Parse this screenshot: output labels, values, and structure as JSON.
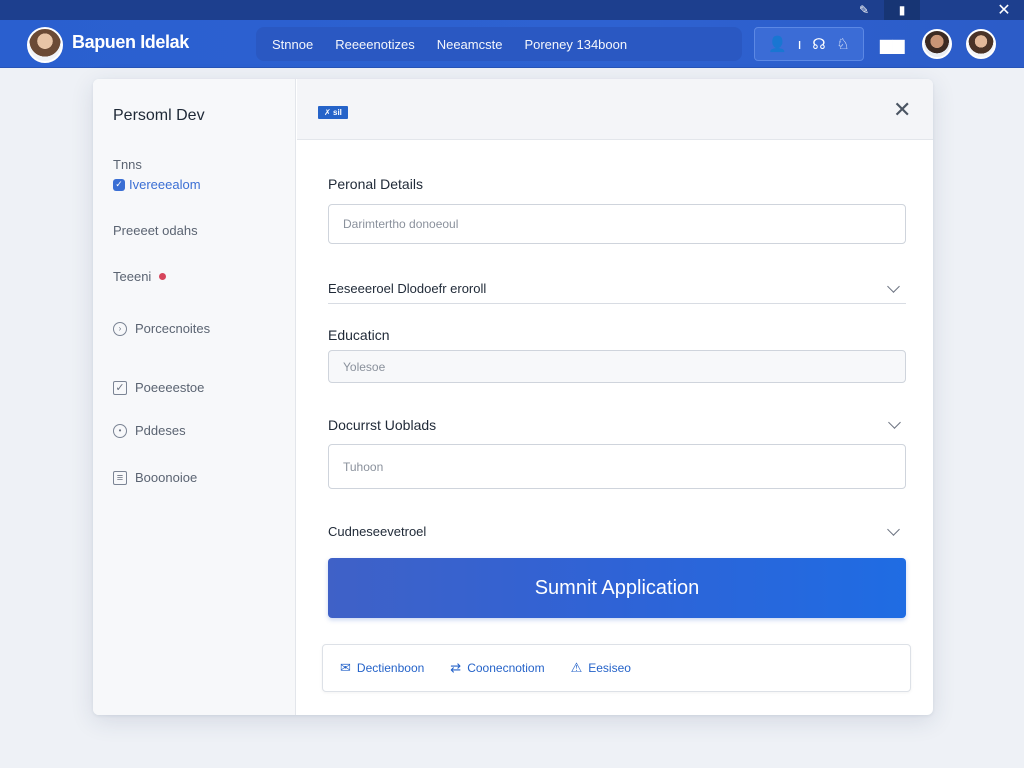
{
  "window": {
    "minimize_glyph": "✎",
    "maximize_glyph": "▮",
    "close_glyph": "✕"
  },
  "header": {
    "brand": "Bapuen Idelak",
    "nav": [
      "Stnnoe",
      "Reeeenotizes",
      "Neeamcste",
      "Poreney 134boon"
    ],
    "tools": [
      "👤",
      "ı",
      "☊",
      "♘"
    ],
    "camera_glyph": "▆▆"
  },
  "dialog": {
    "flag": "✗ sil",
    "close_glyph": "✕"
  },
  "sidebar": {
    "title": "Persoml Dev",
    "group_label": "Tnns",
    "active_sub": "Ivereeealom",
    "items": [
      {
        "label": "Preeeet odahs",
        "icon": "none"
      },
      {
        "label": "Teeeni",
        "icon": "dot"
      },
      {
        "label": "Porcecnoites",
        "icon": "circle"
      },
      {
        "label": "Poeeeestoe",
        "icon": "box"
      },
      {
        "label": "Pddeses",
        "icon": "circle"
      },
      {
        "label": "Booonoioe",
        "icon": "box"
      }
    ]
  },
  "form": {
    "personal_label": "Peronal Details",
    "personal_placeholder": "Darimtertho donoeoul",
    "select1": "Eeseeeroel Dlodoefr eroroll",
    "education_label": "Educaticn",
    "education_placeholder": "Yolesoe",
    "documents_label": "Docurrst Uoblads",
    "documents_placeholder": "Tuhoon",
    "select2": "Cudneseevetroel",
    "submit_label": "Sumnit Application"
  },
  "actions": [
    {
      "label": "Dectienboon",
      "icon": "✉"
    },
    {
      "label": "Coonecnotiom",
      "icon": "⇄"
    },
    {
      "label": "Eesiseo",
      "icon": "⚠"
    }
  ],
  "colors": {
    "header": "#2e62d1",
    "title_strip": "#1d3f8e",
    "accent": "#2563c9",
    "alert_dot": "#d6455b"
  }
}
